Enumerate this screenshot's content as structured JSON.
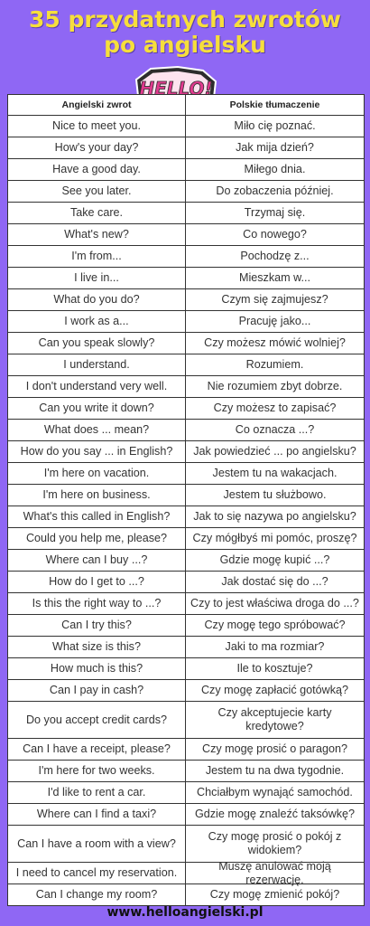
{
  "title": {
    "line1": "35 przydatnych zwrotów",
    "line2": "po angielsku"
  },
  "logo": {
    "text": "HELLO!"
  },
  "table": {
    "headers": [
      "Angielski zwrot",
      "Polskie tłumaczenie"
    ],
    "rows": [
      [
        "Nice to meet you.",
        "Miło cię poznać."
      ],
      [
        "How's your day?",
        "Jak mija dzień?"
      ],
      [
        "Have a good day.",
        "Miłego dnia."
      ],
      [
        "See you later.",
        "Do zobaczenia później."
      ],
      [
        "Take care.",
        "Trzymaj się."
      ],
      [
        "What's new?",
        "Co nowego?"
      ],
      [
        "I'm from...",
        "Pochodzę z..."
      ],
      [
        "I live in...",
        "Mieszkam w..."
      ],
      [
        "What do you do?",
        "Czym się zajmujesz?"
      ],
      [
        "I work as a...",
        "Pracuję jako..."
      ],
      [
        "Can you speak slowly?",
        "Czy możesz mówić wolniej?"
      ],
      [
        "I understand.",
        "Rozumiem."
      ],
      [
        "I don't understand very well.",
        "Nie rozumiem zbyt dobrze."
      ],
      [
        "Can you write it down?",
        "Czy możesz to zapisać?"
      ],
      [
        "What does ... mean?",
        "Co oznacza ...?"
      ],
      [
        "How do you say ... in English?",
        "Jak powiedzieć ... po angielsku?"
      ],
      [
        "I'm here on vacation.",
        "Jestem tu na wakacjach."
      ],
      [
        "I'm here on business.",
        "Jestem tu służbowo."
      ],
      [
        "What's this called in English?",
        "Jak to się nazywa po angielsku?"
      ],
      [
        "Could you help me, please?",
        "Czy mógłbyś mi pomóc, proszę?"
      ],
      [
        "Where can I buy ...?",
        "Gdzie mogę kupić ...?"
      ],
      [
        "How do I get to ...?",
        "Jak dostać się do ...?"
      ],
      [
        "Is this the right way to ...?",
        "Czy to jest właściwa droga do ...?"
      ],
      [
        "Can I try this?",
        "Czy mogę tego spróbować?"
      ],
      [
        "What size is this?",
        "Jaki to ma rozmiar?"
      ],
      [
        "How much is this?",
        "Ile to kosztuje?"
      ],
      [
        "Can I pay in cash?",
        "Czy mogę zapłacić gotówką?"
      ],
      [
        "Do you accept credit cards?",
        "Czy akceptujecie karty kredytowe?"
      ],
      [
        "Can I have a receipt, please?",
        "Czy mogę prosić o paragon?"
      ],
      [
        "I'm here for two weeks.",
        "Jestem tu na dwa tygodnie."
      ],
      [
        "I'd like to rent a car.",
        "Chciałbym wynająć samochód."
      ],
      [
        "Where can I find a taxi?",
        "Gdzie mogę znaleźć taksówkę?"
      ],
      [
        "Can I have a room with a view?",
        "Czy mogę prosić o pokój z widokiem?"
      ],
      [
        "I need to cancel my reservation.",
        "Muszę anulować moją rezerwację."
      ],
      [
        "Can I change my room?",
        "Czy mogę zmienić pokój?"
      ]
    ]
  },
  "footer": {
    "url": "www.helloangielski.pl"
  },
  "colors": {
    "background": "#8f67f4",
    "title": "#f6de3c",
    "logo_text": "#e03a8e",
    "table_bg": "#ffffff"
  }
}
